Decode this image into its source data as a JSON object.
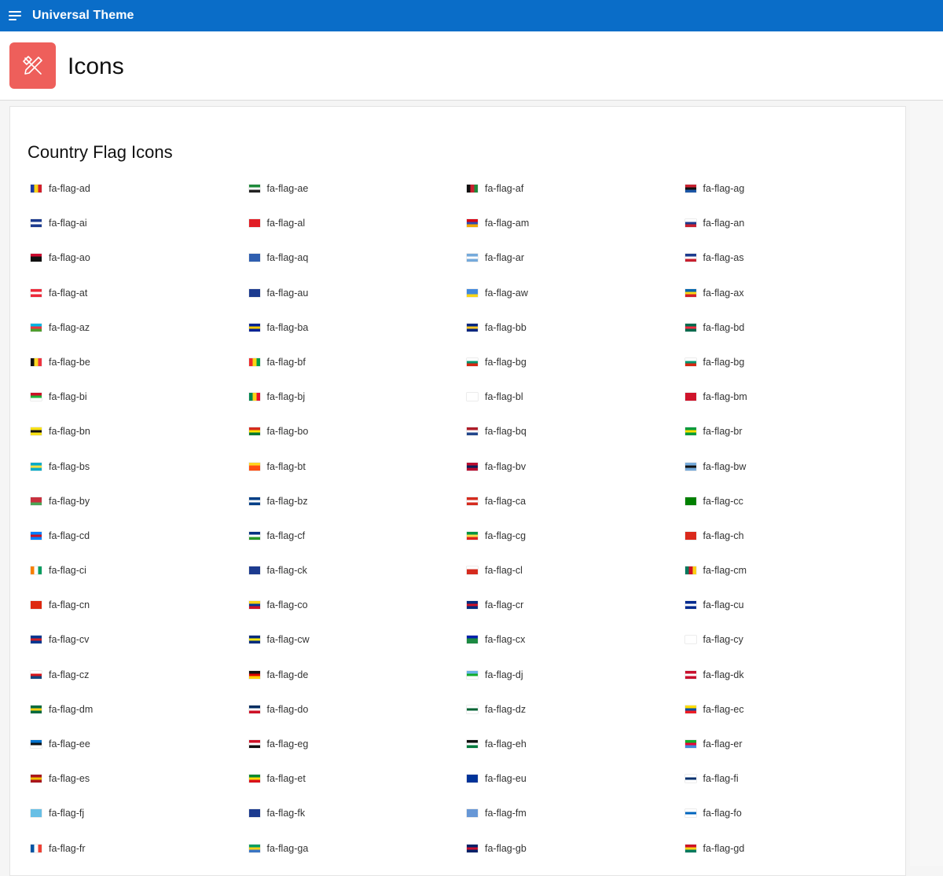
{
  "app": {
    "title": "Universal Theme"
  },
  "header": {
    "title": "Icons"
  },
  "section": {
    "title": "Country Flag Icons"
  },
  "flags": [
    {
      "label": "fa-flag-ad",
      "colors": [
        "#1a3aa8",
        "#f7d417",
        "#d21f2c"
      ]
    },
    {
      "label": "fa-flag-ae",
      "colors": [
        "#1e8a3a",
        "#ffffff",
        "#222222"
      ]
    },
    {
      "label": "fa-flag-af",
      "colors": [
        "#111111",
        "#c8202f",
        "#1f8a3b"
      ]
    },
    {
      "label": "fa-flag-ag",
      "colors": [
        "#c8202f",
        "#111111",
        "#1c57a7"
      ]
    },
    {
      "label": "fa-flag-ai",
      "colors": [
        "#1c3b8f",
        "#ffffff",
        "#1c3b8f"
      ]
    },
    {
      "label": "fa-flag-al",
      "colors": [
        "#e11d25",
        "#e11d25",
        "#e11d25"
      ]
    },
    {
      "label": "fa-flag-am",
      "colors": [
        "#d90012",
        "#2d4bb3",
        "#f2a800"
      ]
    },
    {
      "label": "fa-flag-an",
      "colors": [
        "#ffffff",
        "#1e3b8c",
        "#c8202f"
      ]
    },
    {
      "label": "fa-flag-ao",
      "colors": [
        "#cc092f",
        "#111111",
        "#111111"
      ]
    },
    {
      "label": "fa-flag-aq",
      "colors": [
        "#2f5fb0",
        "#2f5fb0",
        "#2f5fb0"
      ]
    },
    {
      "label": "fa-flag-ar",
      "colors": [
        "#75aadb",
        "#ffffff",
        "#75aadb"
      ]
    },
    {
      "label": "fa-flag-as",
      "colors": [
        "#1c3b8f",
        "#ffffff",
        "#c8202f"
      ]
    },
    {
      "label": "fa-flag-at",
      "colors": [
        "#ed2939",
        "#ffffff",
        "#ed2939"
      ]
    },
    {
      "label": "fa-flag-au",
      "colors": [
        "#1c3b8f",
        "#1c3b8f",
        "#1c3b8f"
      ]
    },
    {
      "label": "fa-flag-aw",
      "colors": [
        "#4189dd",
        "#4189dd",
        "#f9d616"
      ]
    },
    {
      "label": "fa-flag-ax",
      "colors": [
        "#0064ad",
        "#f9d616",
        "#d21f2c"
      ]
    },
    {
      "label": "fa-flag-az",
      "colors": [
        "#00b5e2",
        "#ef3340",
        "#509e2f"
      ]
    },
    {
      "label": "fa-flag-ba",
      "colors": [
        "#002395",
        "#fecb00",
        "#002395"
      ]
    },
    {
      "label": "fa-flag-bb",
      "colors": [
        "#00267f",
        "#ffc726",
        "#00267f"
      ]
    },
    {
      "label": "fa-flag-bd",
      "colors": [
        "#006a4e",
        "#f42a41",
        "#006a4e"
      ]
    },
    {
      "label": "fa-flag-be",
      "colors": [
        "#111111",
        "#fdda24",
        "#ef3340"
      ]
    },
    {
      "label": "fa-flag-bf",
      "colors": [
        "#ef2b2d",
        "#f9d616",
        "#009e49"
      ]
    },
    {
      "label": "fa-flag-bg",
      "colors": [
        "#ffffff",
        "#00966e",
        "#d62612"
      ]
    },
    {
      "label": "fa-flag-bg",
      "colors": [
        "#ffffff",
        "#00966e",
        "#d62612"
      ]
    },
    {
      "label": "fa-flag-bi",
      "colors": [
        "#ce1126",
        "#1eb53a",
        "#ffffff"
      ]
    },
    {
      "label": "fa-flag-bj",
      "colors": [
        "#008751",
        "#fcd116",
        "#e8112d"
      ]
    },
    {
      "label": "fa-flag-bl",
      "colors": [
        "#ffffff",
        "#ffffff",
        "#ffffff"
      ]
    },
    {
      "label": "fa-flag-bm",
      "colors": [
        "#cf142b",
        "#cf142b",
        "#cf142b"
      ]
    },
    {
      "label": "fa-flag-bn",
      "colors": [
        "#f7e017",
        "#111111",
        "#f7e017"
      ]
    },
    {
      "label": "fa-flag-bo",
      "colors": [
        "#d52b1e",
        "#f9e300",
        "#007934"
      ]
    },
    {
      "label": "fa-flag-bq",
      "colors": [
        "#ae1c28",
        "#ffffff",
        "#21468b"
      ]
    },
    {
      "label": "fa-flag-br",
      "colors": [
        "#009b3a",
        "#fedf00",
        "#009b3a"
      ]
    },
    {
      "label": "fa-flag-bs",
      "colors": [
        "#00abc9",
        "#fae042",
        "#00abc9"
      ]
    },
    {
      "label": "fa-flag-bt",
      "colors": [
        "#ffd520",
        "#ff4e12",
        "#ff4e12"
      ]
    },
    {
      "label": "fa-flag-bv",
      "colors": [
        "#ba0c2f",
        "#00205b",
        "#ba0c2f"
      ]
    },
    {
      "label": "fa-flag-bw",
      "colors": [
        "#75aadb",
        "#111111",
        "#75aadb"
      ]
    },
    {
      "label": "fa-flag-by",
      "colors": [
        "#c8313e",
        "#c8313e",
        "#4aa657"
      ]
    },
    {
      "label": "fa-flag-bz",
      "colors": [
        "#003f87",
        "#ffffff",
        "#003f87"
      ]
    },
    {
      "label": "fa-flag-ca",
      "colors": [
        "#d52b1e",
        "#ffffff",
        "#d52b1e"
      ]
    },
    {
      "label": "fa-flag-cc",
      "colors": [
        "#008000",
        "#008000",
        "#008000"
      ]
    },
    {
      "label": "fa-flag-cd",
      "colors": [
        "#007fff",
        "#ce1021",
        "#007fff"
      ]
    },
    {
      "label": "fa-flag-cf",
      "colors": [
        "#003082",
        "#ffffff",
        "#289728"
      ]
    },
    {
      "label": "fa-flag-cg",
      "colors": [
        "#009543",
        "#fbde4a",
        "#dc241f"
      ]
    },
    {
      "label": "fa-flag-ch",
      "colors": [
        "#da291c",
        "#da291c",
        "#da291c"
      ]
    },
    {
      "label": "fa-flag-ci",
      "colors": [
        "#f77f00",
        "#ffffff",
        "#009e60"
      ]
    },
    {
      "label": "fa-flag-ck",
      "colors": [
        "#1c3b8f",
        "#1c3b8f",
        "#1c3b8f"
      ]
    },
    {
      "label": "fa-flag-cl",
      "colors": [
        "#ffffff",
        "#d52b1e",
        "#d52b1e"
      ]
    },
    {
      "label": "fa-flag-cm",
      "colors": [
        "#007a5e",
        "#ce1126",
        "#fcd116"
      ]
    },
    {
      "label": "fa-flag-cn",
      "colors": [
        "#de2910",
        "#de2910",
        "#de2910"
      ]
    },
    {
      "label": "fa-flag-co",
      "colors": [
        "#fcd116",
        "#003893",
        "#ce1126"
      ]
    },
    {
      "label": "fa-flag-cr",
      "colors": [
        "#002b7f",
        "#ce1126",
        "#002b7f"
      ]
    },
    {
      "label": "fa-flag-cu",
      "colors": [
        "#002a8f",
        "#ffffff",
        "#002a8f"
      ]
    },
    {
      "label": "fa-flag-cv",
      "colors": [
        "#003893",
        "#cf2027",
        "#003893"
      ]
    },
    {
      "label": "fa-flag-cw",
      "colors": [
        "#002b7f",
        "#f9e814",
        "#002b7f"
      ]
    },
    {
      "label": "fa-flag-cx",
      "colors": [
        "#0021ad",
        "#1c8a42",
        "#1c8a42"
      ]
    },
    {
      "label": "fa-flag-cy",
      "colors": [
        "#ffffff",
        "#ffffff",
        "#ffffff"
      ]
    },
    {
      "label": "fa-flag-cz",
      "colors": [
        "#ffffff",
        "#d7141a",
        "#11457e"
      ]
    },
    {
      "label": "fa-flag-de",
      "colors": [
        "#111111",
        "#dd0000",
        "#ffce00"
      ]
    },
    {
      "label": "fa-flag-dj",
      "colors": [
        "#6ab2e7",
        "#12ad2b",
        "#ffffff"
      ]
    },
    {
      "label": "fa-flag-dk",
      "colors": [
        "#c8102e",
        "#ffffff",
        "#c8102e"
      ]
    },
    {
      "label": "fa-flag-dm",
      "colors": [
        "#006b3f",
        "#fcd116",
        "#006b3f"
      ]
    },
    {
      "label": "fa-flag-do",
      "colors": [
        "#002d62",
        "#ffffff",
        "#ce1126"
      ]
    },
    {
      "label": "fa-flag-dz",
      "colors": [
        "#ffffff",
        "#006233",
        "#ffffff"
      ]
    },
    {
      "label": "fa-flag-ec",
      "colors": [
        "#ffdd00",
        "#034ea2",
        "#ed1c24"
      ]
    },
    {
      "label": "fa-flag-ee",
      "colors": [
        "#0072ce",
        "#111111",
        "#ffffff"
      ]
    },
    {
      "label": "fa-flag-eg",
      "colors": [
        "#ce1126",
        "#ffffff",
        "#111111"
      ]
    },
    {
      "label": "fa-flag-eh",
      "colors": [
        "#111111",
        "#ffffff",
        "#007a3d"
      ]
    },
    {
      "label": "fa-flag-er",
      "colors": [
        "#12ad2b",
        "#ea0437",
        "#4189dd"
      ]
    },
    {
      "label": "fa-flag-es",
      "colors": [
        "#aa151b",
        "#f1bf00",
        "#aa151b"
      ]
    },
    {
      "label": "fa-flag-et",
      "colors": [
        "#078930",
        "#fcdd09",
        "#da121a"
      ]
    },
    {
      "label": "fa-flag-eu",
      "colors": [
        "#003399",
        "#003399",
        "#003399"
      ]
    },
    {
      "label": "fa-flag-fi",
      "colors": [
        "#ffffff",
        "#002f6c",
        "#ffffff"
      ]
    },
    {
      "label": "fa-flag-fj",
      "colors": [
        "#68bfe5",
        "#68bfe5",
        "#68bfe5"
      ]
    },
    {
      "label": "fa-flag-fk",
      "colors": [
        "#1c3b8f",
        "#1c3b8f",
        "#1c3b8f"
      ]
    },
    {
      "label": "fa-flag-fm",
      "colors": [
        "#6797d6",
        "#6797d6",
        "#6797d6"
      ]
    },
    {
      "label": "fa-flag-fo",
      "colors": [
        "#ffffff",
        "#0065bd",
        "#ffffff"
      ]
    },
    {
      "label": "fa-flag-fr",
      "colors": [
        "#0055a4",
        "#ffffff",
        "#ef4135"
      ]
    },
    {
      "label": "fa-flag-ga",
      "colors": [
        "#009e60",
        "#fcd116",
        "#3a75c4"
      ]
    },
    {
      "label": "fa-flag-gb",
      "colors": [
        "#012169",
        "#c8102e",
        "#012169"
      ]
    },
    {
      "label": "fa-flag-gd",
      "colors": [
        "#ce1126",
        "#fcd116",
        "#007a5e"
      ]
    }
  ]
}
